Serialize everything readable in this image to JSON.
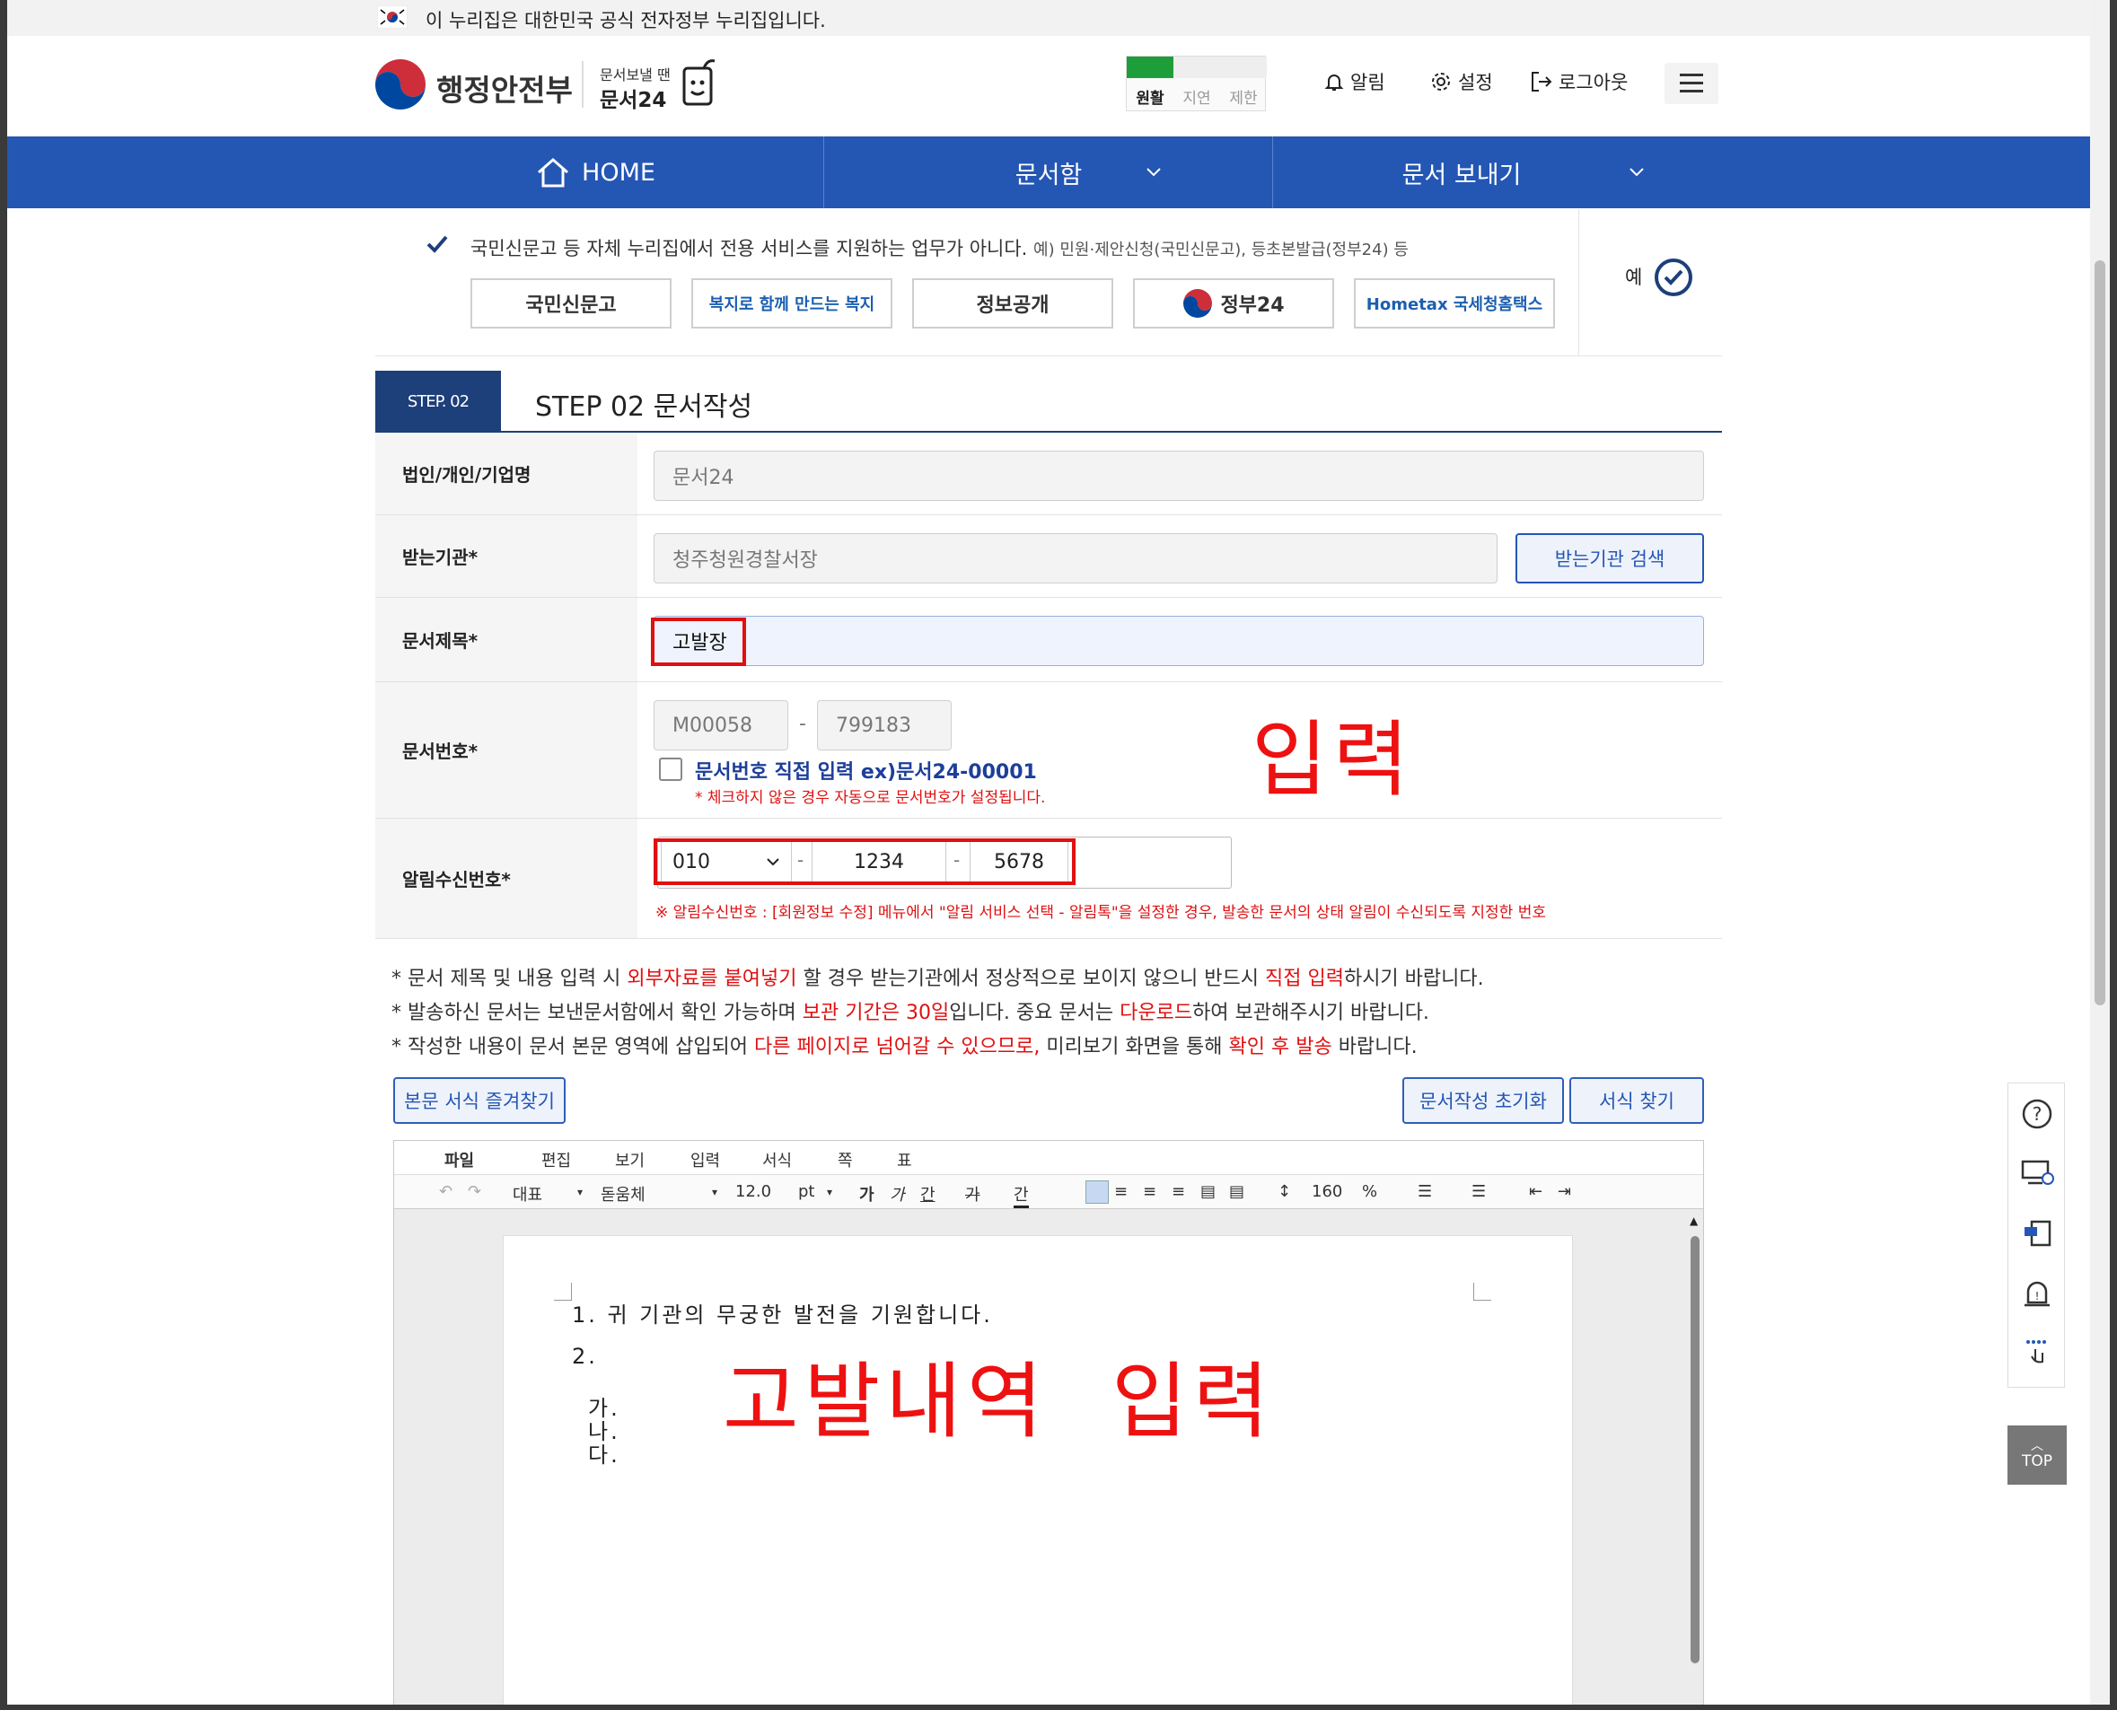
{
  "banner": {
    "text": "이 누리집은 대한민국 공식 전자정부 누리집입니다."
  },
  "header": {
    "ministry": "행정안전부",
    "service_small": "문서보낼 땐",
    "service_name": "문서24",
    "speed": {
      "smooth": "원활",
      "delay": "지연",
      "limit": "제한"
    },
    "alarm": "알림",
    "settings": "설정",
    "logout": "로그아웃"
  },
  "nav": {
    "home": "HOME",
    "docbox": "문서함",
    "send": "문서 보내기"
  },
  "notice": {
    "text": "국민신문고 등 자체 누리집에서 전용 서비스를 지원하는 업무가 아니다.",
    "example": "예) 민원·제안신청(국민신문고), 등초본발급(정부24) 등",
    "services": [
      "국민신문고",
      "복지로 함께 만드는 복지",
      "정보공개",
      "정부24",
      "Hometax 국세청홈택스"
    ],
    "yes": "예"
  },
  "step": {
    "tab": "STEP. 02",
    "title": "STEP 02 문서작성"
  },
  "form": {
    "corp_label": "법인/개인/기업명",
    "corp_value": "문서24",
    "receiver_label": "받는기관*",
    "receiver_value": "청주청원경찰서장",
    "receiver_search": "받는기관 검색",
    "title_label": "문서제목*",
    "title_value": "고발장",
    "docnum_label": "문서번호*",
    "docnum_prefix": "M00058",
    "docnum_dash": "-",
    "docnum_number": "799183",
    "docnum_checkbox": "문서번호 직접 입력 ex)문서24-00001",
    "docnum_hint": "* 체크하지 않은 경우 자동으로 문서번호가 설정됩니다.",
    "phone_label": "알림수신번호*",
    "phone_1": "010",
    "phone_2": "1234",
    "phone_3": "5678",
    "phone_hint": "※ 알림수신번호 : [회원정보 수정] 메뉴에서 \"알림 서비스 선택 - 알림톡\"을 설정한 경우, 발송한 문서의 상태 알림이 수신되도록 지정한 번호"
  },
  "annotations": {
    "input": "입력",
    "content_input": "고발내역  입력"
  },
  "notes": {
    "n1_a": "* 문서 제목 및 내용 입력 시 ",
    "n1_b": "외부자료를 붙여넣기",
    "n1_c": " 할 경우 받는기관에서 정상적으로 보이지 않으니 반드시 ",
    "n1_d": "직접 입력",
    "n1_e": "하시기 바랍니다.",
    "n2_a": "* 발송하신 문서는 보낸문서함에서 확인 가능하며 ",
    "n2_b": "보관 기간은 30일",
    "n2_c": "입니다. 중요 문서는 ",
    "n2_d": "다운로드",
    "n2_e": "하여 보관해주시기 바랍니다.",
    "n3_a": "* 작성한 내용이 문서 본문 영역에 삽입되어 ",
    "n3_b": "다른 페이지로 넘어갈 수 있으므로,",
    "n3_c": " 미리보기 화면을 통해 ",
    "n3_d": "확인 후 발송",
    "n3_e": " 바랍니다."
  },
  "buttons": {
    "favorites": "본문 서식 즐겨찾기",
    "reset": "문서작성 초기화",
    "find_form": "서식 찾기"
  },
  "editor": {
    "menus": [
      "파일",
      "편집",
      "보기",
      "입력",
      "서식",
      "쪽",
      "표"
    ],
    "style": "대표",
    "font": "돋움체",
    "size": "12.0",
    "unit": "pt",
    "line_spacing": "160",
    "percent": "%",
    "lines": [
      "1. 귀 기관의 무궁한 발전을 기원합니다.",
      "2.",
      "가.",
      "나.",
      "다."
    ]
  },
  "side": {
    "top": "TOP"
  }
}
